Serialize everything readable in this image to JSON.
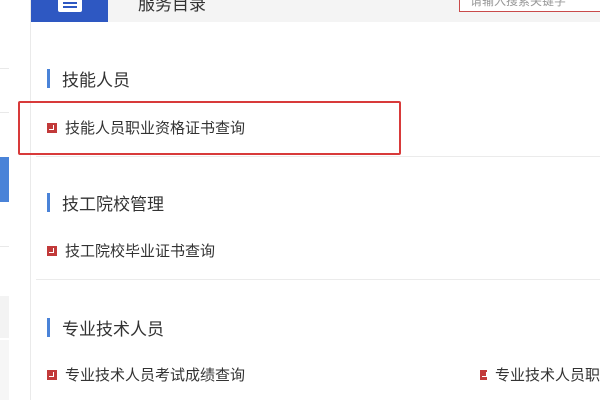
{
  "header": {
    "title": "服务目录",
    "search_placeholder": "请输入搜索关键字"
  },
  "sections": [
    {
      "title": "技能人员",
      "items": [
        {
          "label": "技能人员职业资格证书查询"
        }
      ]
    },
    {
      "title": "技工院校管理",
      "items": [
        {
          "label": "技工院校毕业证书查询"
        }
      ]
    },
    {
      "title": "专业技术人员",
      "items": [
        {
          "label": "专业技术人员考试成绩查询"
        },
        {
          "label": "专业技术人员职"
        }
      ]
    }
  ],
  "colors": {
    "accent_blue": "#4a83d8",
    "header_button": "#2e58c2",
    "highlight_red": "#d83a3a",
    "bullet_red": "#c23a3a"
  }
}
